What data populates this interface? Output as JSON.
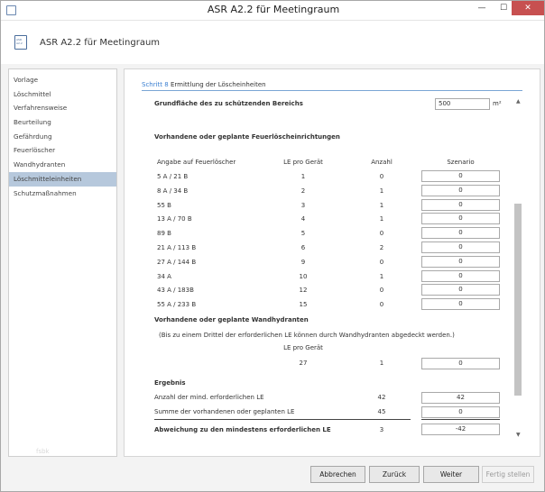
{
  "window": {
    "title": "ASR A2.2 für Meetingraum",
    "minimize": "—",
    "maximize": "☐",
    "close": "✕"
  },
  "header": {
    "icon_text": "ASR A2.2",
    "title": "ASR A2.2 für Meetingraum"
  },
  "sidebar": {
    "items": [
      {
        "label": "Vorlage",
        "active": false
      },
      {
        "label": "Löschmittel",
        "active": false
      },
      {
        "label": "Verfahrensweise",
        "active": false
      },
      {
        "label": "Beurteilung",
        "active": false
      },
      {
        "label": "Gefährdung",
        "active": false
      },
      {
        "label": "Feuerlöscher",
        "active": false
      },
      {
        "label": "Wandhydranten",
        "active": false
      },
      {
        "label": "Löschmitteleinheiten",
        "active": true
      },
      {
        "label": "Schutzmaßnahmen",
        "active": false
      }
    ],
    "watermark": "fsbk"
  },
  "step": {
    "number": "Schritt 8",
    "title": "Ermittlung der Löscheinheiten"
  },
  "area": {
    "label": "Grundfläche des zu schützenden Bereichs",
    "value": "500",
    "unit": "m²"
  },
  "extinguishers": {
    "heading": "Vorhandene oder geplante Feuerlöscheinrichtungen",
    "columns": [
      "Angabe auf Feuerlöscher",
      "LE pro Gerät",
      "Anzahl",
      "Szenario"
    ],
    "rows": [
      {
        "label": "5 A / 21 B",
        "le": "1",
        "count": "0",
        "scenario": "0"
      },
      {
        "label": "8 A / 34 B",
        "le": "2",
        "count": "1",
        "scenario": "0"
      },
      {
        "label": "55 B",
        "le": "3",
        "count": "1",
        "scenario": "0"
      },
      {
        "label": "13 A / 70 B",
        "le": "4",
        "count": "1",
        "scenario": "0"
      },
      {
        "label": "89 B",
        "le": "5",
        "count": "0",
        "scenario": "0"
      },
      {
        "label": "21 A / 113 B",
        "le": "6",
        "count": "2",
        "scenario": "0"
      },
      {
        "label": "27 A / 144 B",
        "le": "9",
        "count": "0",
        "scenario": "0"
      },
      {
        "label": "34 A",
        "le": "10",
        "count": "1",
        "scenario": "0"
      },
      {
        "label": "43 A / 183B",
        "le": "12",
        "count": "0",
        "scenario": "0"
      },
      {
        "label": "55 A / 233 B",
        "le": "15",
        "count": "0",
        "scenario": "0"
      }
    ]
  },
  "hydrants": {
    "heading": "Vorhandene oder geplante Wandhydranten",
    "note": "(Bis zu einem Drittel der erforderlichen LE können durch Wandhydranten abgedeckt werden.)",
    "le_header": "LE pro Gerät",
    "le": "27",
    "count": "1",
    "scenario": "0"
  },
  "result": {
    "heading": "Ergebnis",
    "required_label": "Anzahl der mind. erforderlichen LE",
    "required_value": "42",
    "required_scenario": "42",
    "sum_label": "Summe der vorhandenen oder geplanten LE",
    "sum_value": "45",
    "sum_scenario": "0",
    "deviation_label": "Abweichung zu den mindestens erforderlichen LE",
    "deviation_value": "3",
    "deviation_scenario": "-42"
  },
  "buttons": {
    "cancel": "Abbrechen",
    "back": "Zurück",
    "next": "Weiter",
    "finish": "Fertig stellen"
  }
}
